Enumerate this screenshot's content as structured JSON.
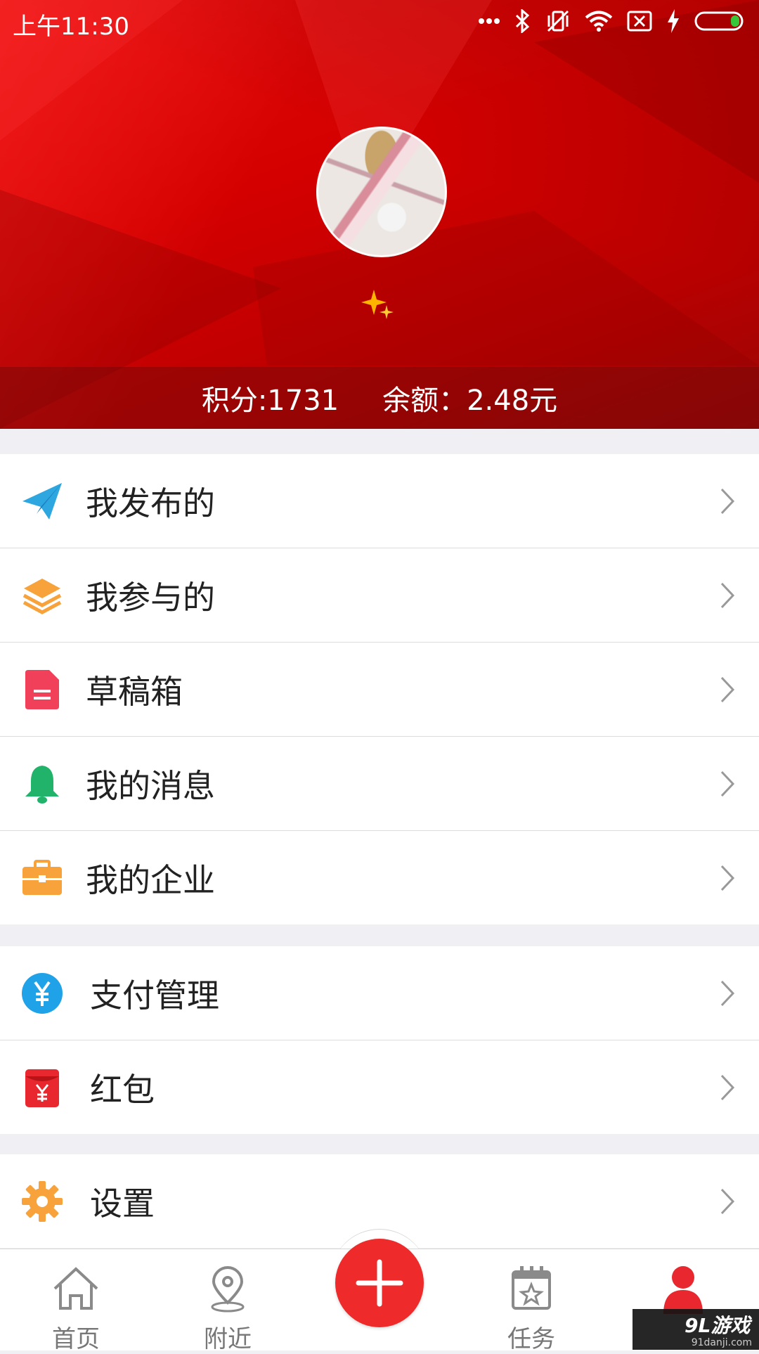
{
  "status_bar": {
    "time": "上午11:30"
  },
  "profile": {
    "points_text": "积分:1731",
    "balance_text": "余额：2.48元"
  },
  "menu_groups": [
    [
      {
        "label": "我发布的",
        "icon": "paper-plane-icon",
        "color": "#2ea7e0"
      },
      {
        "label": "我参与的",
        "icon": "layers-icon",
        "color": "#f7a23b"
      },
      {
        "label": "草稿箱",
        "icon": "document-icon",
        "color": "#f0405a"
      },
      {
        "label": "我的消息",
        "icon": "bell-icon",
        "color": "#21b36a"
      },
      {
        "label": "我的企业",
        "icon": "briefcase-icon",
        "color": "#f7a23b"
      }
    ],
    [
      {
        "label": "支付管理",
        "icon": "yuan-coin-icon",
        "color": "#1fa2e8"
      },
      {
        "label": "红包",
        "icon": "red-envelope-icon",
        "color": "#e8282e"
      }
    ],
    [
      {
        "label": "设置",
        "icon": "gear-icon",
        "color": "#f7a23b"
      }
    ]
  ],
  "tabbar": {
    "home": "首页",
    "nearby": "附近",
    "tasks": "任务"
  },
  "watermark": {
    "logo": "9L游戏",
    "url": "91danji.com"
  },
  "colors": {
    "header_red": "#d40000",
    "fab_red": "#ee2a2a",
    "active_tab": "#e8282e"
  }
}
